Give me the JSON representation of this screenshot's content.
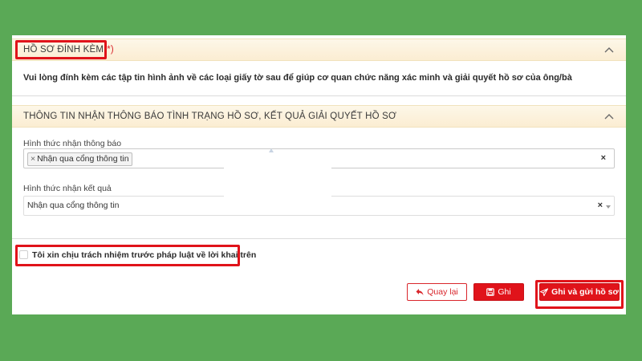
{
  "attachments": {
    "title": "HỒ SƠ ĐÍNH KÈM",
    "required_mark": "(*)",
    "instruction": "Vui lòng đính kèm các tập tin hình ảnh về các loại giấy tờ sau để giúp cơ quan chức năng xác minh và giải quyết hồ sơ của ông/bà"
  },
  "notification": {
    "title": "THÔNG TIN NHẬN THÔNG BÁO TÌNH TRẠNG HỒ SƠ, KẾT QUẢ GIẢI QUYẾT HỒ SƠ",
    "notify_method": {
      "label": "Hình thức nhận thông báo",
      "selected_tag": "Nhận qua cổng thông tin",
      "tag_remove": "×",
      "clear": "×"
    },
    "result_method": {
      "label": "Hình thức nhận kết quả",
      "value": "Nhận qua cổng thông tin",
      "clear": "×"
    }
  },
  "declaration": {
    "text": "Tôi xin chịu trách nhiệm trước pháp luật về lời khai trên",
    "checked": false
  },
  "actions": {
    "back_label": "Quay lại",
    "save_label": "Ghi",
    "submit_label": "Ghi và gửi hồ sơ"
  },
  "colors": {
    "background": "#5aa956",
    "accent": "#e0131a",
    "header_bg": "#fbedd2"
  },
  "icons": {
    "collapse": "chevron-up-icon",
    "back": "reply-arrow-icon",
    "save": "floppy-disk-icon",
    "submit": "paper-plane-icon"
  }
}
